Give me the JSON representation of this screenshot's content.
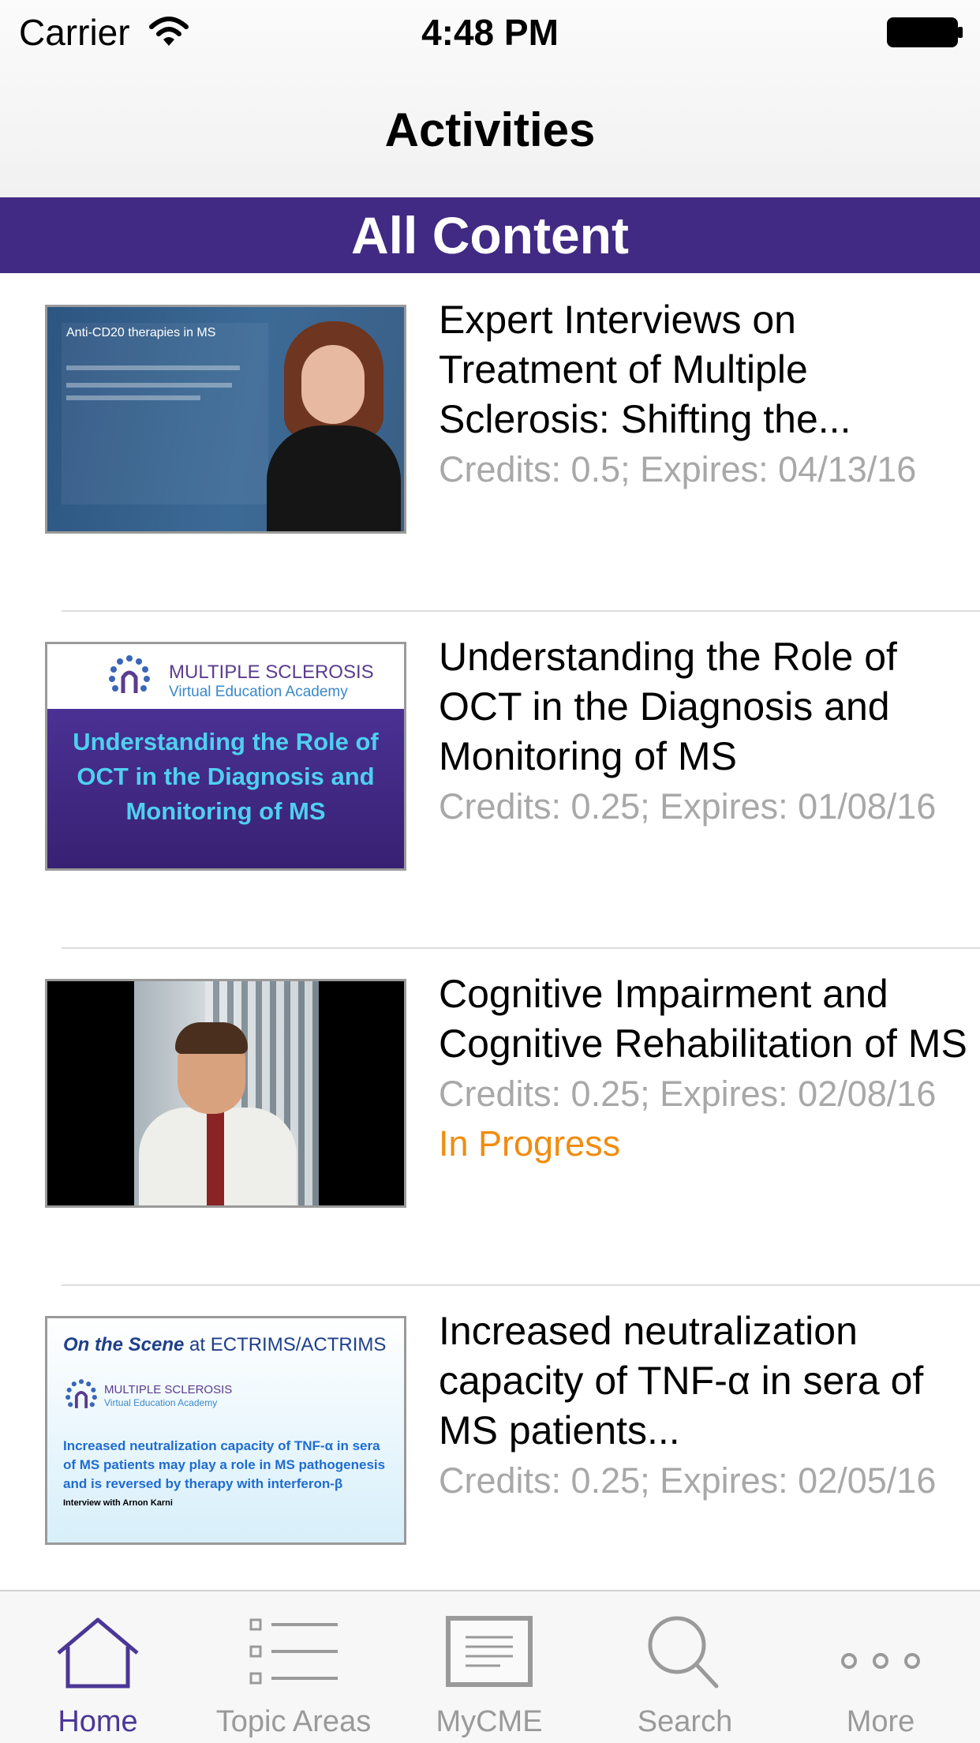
{
  "status_bar": {
    "carrier": "Carrier",
    "time": "4:48 PM"
  },
  "nav": {
    "title": "Activities"
  },
  "section": {
    "title": "All Content"
  },
  "items": [
    {
      "title": "Expert Interviews on Treatment of Multiple Sclerosis: Shifting the...",
      "meta": "Credits: 0.5; Expires: 04/13/16",
      "status": "",
      "thumb": {
        "heading": "Anti-CD20 therapies in MS"
      }
    },
    {
      "title": "Understanding the Role of OCT in the Diagnosis and Monitoring of MS",
      "meta": "Credits: 0.25; Expires: 01/08/16",
      "status": "",
      "thumb": {
        "org_line1": "MULTIPLE SCLEROSIS",
        "org_line2": "Virtual Education Academy",
        "caption": "Understanding the Role of OCT in the Diagnosis and Monitoring of MS"
      }
    },
    {
      "title": "Cognitive Impairment and Cognitive Rehabilitation of MS",
      "meta": "Credits: 0.25; Expires: 02/08/16",
      "status": "In Progress",
      "thumb": {}
    },
    {
      "title": "Increased neutralization capacity of TNF-α in sera of MS patients...",
      "meta": "Credits: 0.25; Expires: 02/05/16",
      "status": "",
      "thumb": {
        "banner_em": "On the Scene",
        "banner_rest": " at ECTRIMS/ACTRIMS",
        "org_line1": "MULTIPLE SCLEROSIS",
        "org_line2": "Virtual Education Academy",
        "body": "Increased neutralization capacity of TNF-α in sera of MS patients may play a role in MS pathogenesis and is reversed by therapy with interferon-β",
        "sub": "Interview with Arnon Karni"
      }
    }
  ],
  "tabbar": {
    "tabs": [
      {
        "label": "Home",
        "icon": "home-icon",
        "active": true
      },
      {
        "label": "Topic Areas",
        "icon": "list-icon",
        "active": false
      },
      {
        "label": "MyCME",
        "icon": "document-icon",
        "active": false
      },
      {
        "label": "Search",
        "icon": "search-icon",
        "active": false
      },
      {
        "label": "More",
        "icon": "more-icon",
        "active": false
      }
    ]
  },
  "colors": {
    "brand_purple": "#402a83",
    "status_orange": "#f08c0f",
    "meta_gray": "#a8a8a8"
  }
}
